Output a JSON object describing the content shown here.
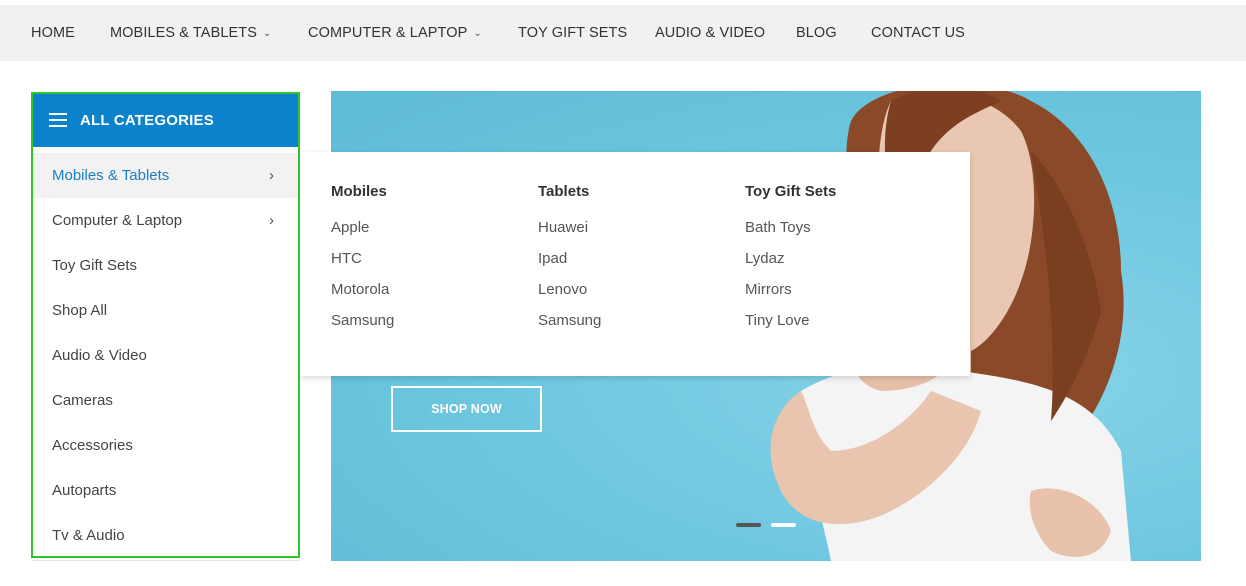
{
  "nav": {
    "items": [
      {
        "label": "HOME",
        "has_dropdown": false
      },
      {
        "label": "MOBILES & TABLETS",
        "has_dropdown": true
      },
      {
        "label": "COMPUTER & LAPTOP",
        "has_dropdown": true
      },
      {
        "label": "TOY GIFT SETS",
        "has_dropdown": false
      },
      {
        "label": "AUDIO & VIDEO",
        "has_dropdown": false
      },
      {
        "label": "BLOG",
        "has_dropdown": false
      },
      {
        "label": "CONTACT US",
        "has_dropdown": false
      }
    ],
    "dropdown_icon": "chevron-down-icon"
  },
  "sidebar": {
    "title": "ALL CATEGORIES",
    "menu_icon": "hamburger-icon",
    "header_color": "#0a82cc",
    "items": [
      {
        "label": "Mobiles & Tablets",
        "has_submenu": true,
        "active": true
      },
      {
        "label": "Computer & Laptop",
        "has_submenu": true,
        "active": false
      },
      {
        "label": "Toy Gift Sets",
        "has_submenu": false,
        "active": false
      },
      {
        "label": "Shop All",
        "has_submenu": false,
        "active": false
      },
      {
        "label": "Audio & Video",
        "has_submenu": false,
        "active": false
      },
      {
        "label": "Cameras",
        "has_submenu": false,
        "active": false
      },
      {
        "label": "Accessories",
        "has_submenu": false,
        "active": false
      },
      {
        "label": "Autoparts",
        "has_submenu": false,
        "active": false
      },
      {
        "label": "Tv & Audio",
        "has_submenu": false,
        "active": false
      }
    ],
    "submenu_icon": "chevron-right-icon",
    "active_color": "#1a7fc6"
  },
  "mega_menu": {
    "columns": [
      {
        "title": "Mobiles",
        "links": [
          "Apple",
          "HTC",
          "Motorola",
          "Samsung"
        ]
      },
      {
        "title": "Tablets",
        "links": [
          "Huawei",
          "Ipad",
          "Lenovo",
          "Samsung"
        ]
      },
      {
        "title": "Toy Gift Sets",
        "links": [
          "Bath Toys",
          "Lydaz",
          "Mirrors",
          "Tiny Love"
        ]
      }
    ]
  },
  "hero": {
    "cta_label": "SHOP NOW",
    "background_color": "#6cc6df",
    "slides": [
      {
        "active": false
      },
      {
        "active": true
      }
    ]
  }
}
